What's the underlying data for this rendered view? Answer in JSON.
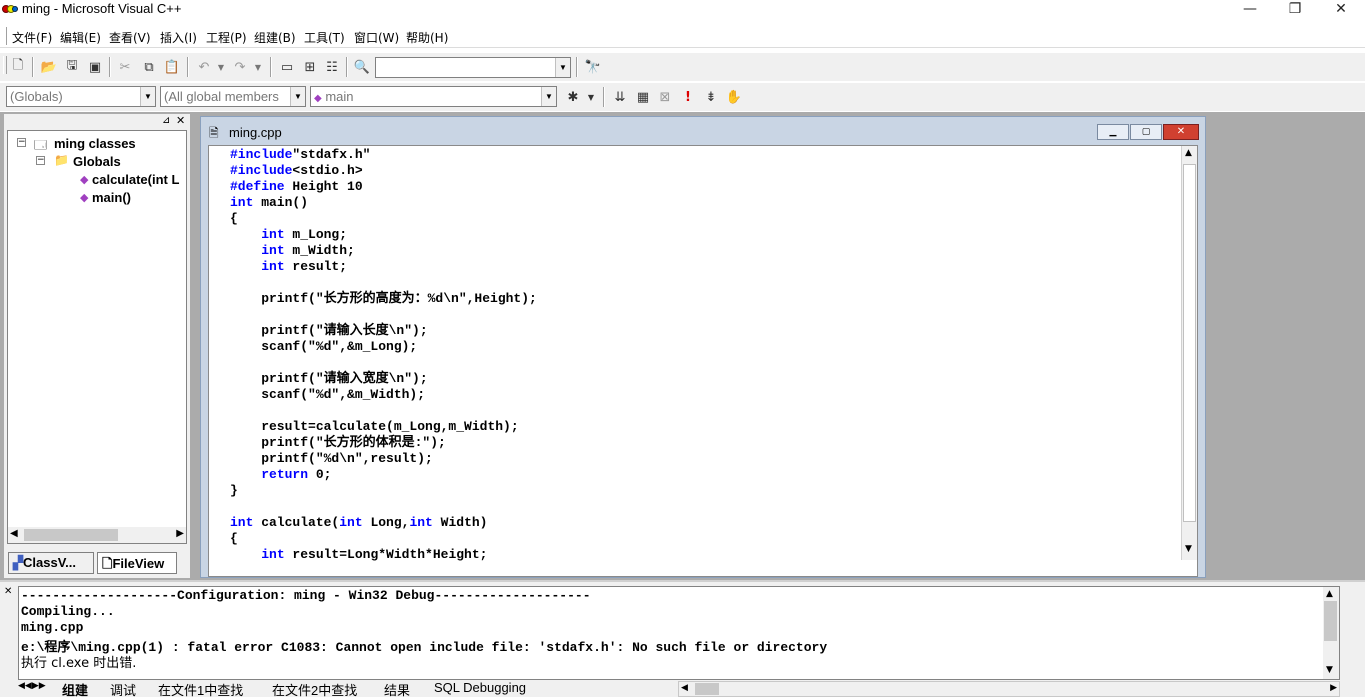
{
  "window": {
    "title": "ming - Microsoft Visual C++",
    "min": "—",
    "max": "❐",
    "close": "✕"
  },
  "menu": [
    "文件(F)",
    "编辑(E)",
    "查看(V)",
    "插入(I)",
    "工程(P)",
    "组建(B)",
    "工具(T)",
    "窗口(W)",
    "帮助(H)"
  ],
  "toolbar": {
    "find_combo": "",
    "globals_combo": "(Globals)",
    "members_combo": "(All global members",
    "function_combo": "main"
  },
  "classview": {
    "root": "ming classes",
    "globals": "Globals",
    "items": [
      "calculate(int L",
      "main()"
    ],
    "tabs": [
      "ClassV...",
      "FileView"
    ]
  },
  "editor": {
    "filename": "ming.cpp",
    "lines": [
      "#include\"stdafx.h\"",
      "#include<stdio.h>",
      "#define Height 10",
      "int main()",
      "{",
      "    int m_Long;",
      "    int m_Width;",
      "    int result;",
      "",
      "    printf(\"长方形的高度为：%d\\n\",Height);",
      "",
      "    printf(\"请输入长度\\n\");",
      "    scanf(\"%d\",&m_Long);",
      "",
      "    printf(\"请输入宽度\\n\");",
      "    scanf(\"%d\",&m_Width);",
      "",
      "    result=calculate(m_Long,m_Width);",
      "    printf(\"长方形的体积是:\");",
      "    printf(\"%d\\n\",result);",
      "    return 0;",
      "}",
      "",
      "int calculate(int Long,int Width)",
      "{",
      "    int result=Long*Width*Height;"
    ]
  },
  "output": {
    "lines": [
      "--------------------Configuration: ming - Win32 Debug--------------------",
      "Compiling...",
      "ming.cpp",
      "e:\\程序\\ming.cpp(1) : fatal error C1083: Cannot open include file: 'stdafx.h': No such file or directory",
      "执行 cl.exe 时出错."
    ],
    "tabs": [
      "组建",
      "调试",
      "在文件1中查找",
      "在文件2中查找",
      "结果",
      "SQL Debugging"
    ]
  }
}
